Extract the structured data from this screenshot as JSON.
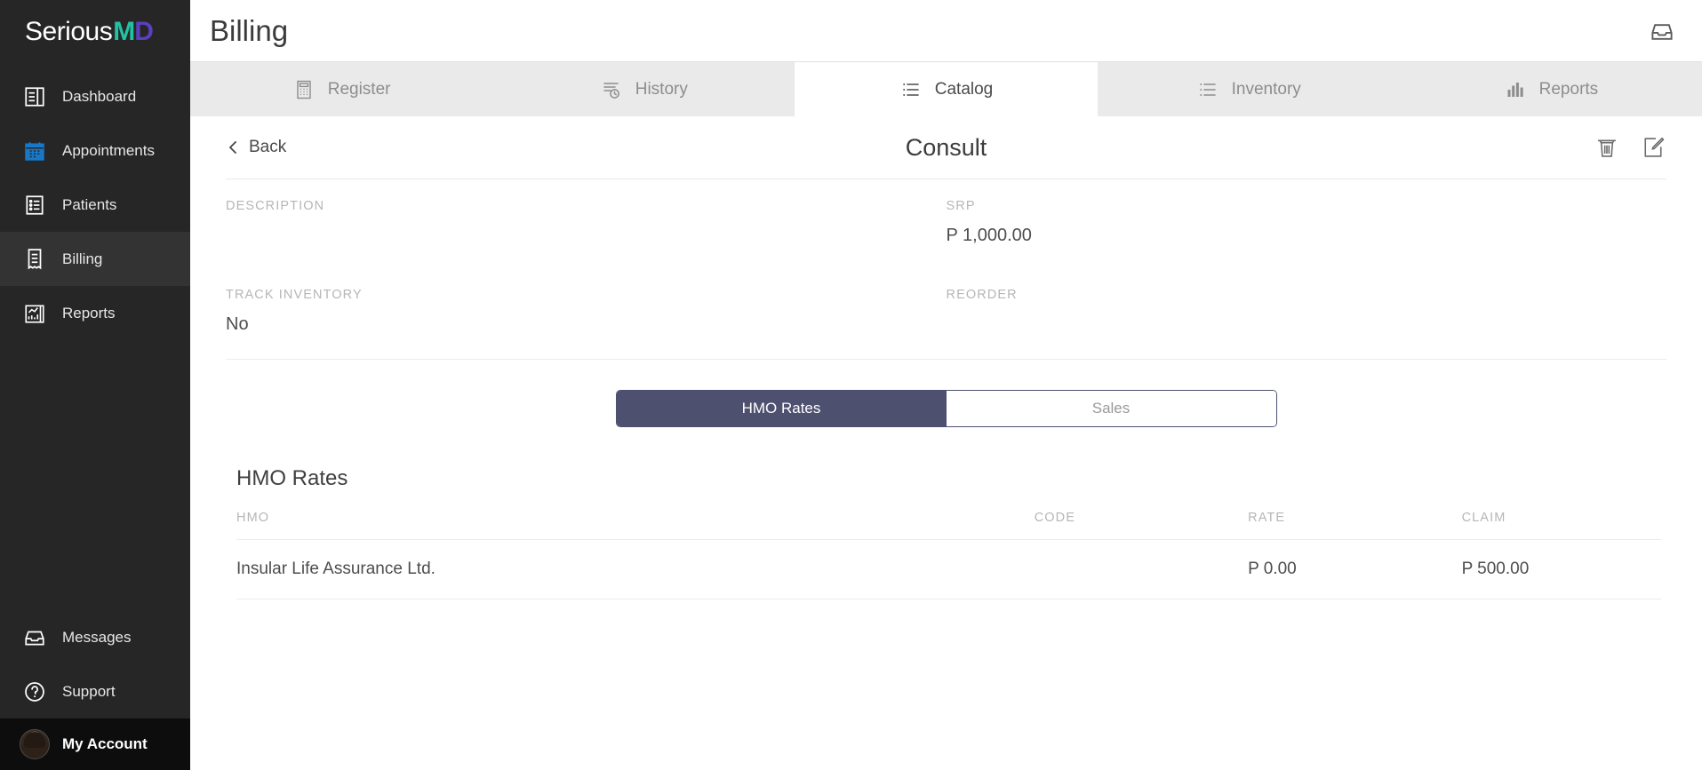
{
  "sidebar": {
    "logo": {
      "text_plain": "Serious",
      "text_m": "M",
      "text_d": "D"
    },
    "items": [
      {
        "label": "Dashboard",
        "icon": "dashboard-icon",
        "active": false
      },
      {
        "label": "Appointments",
        "icon": "calendar-icon",
        "active": false
      },
      {
        "label": "Patients",
        "icon": "patient-list-icon",
        "active": false
      },
      {
        "label": "Billing",
        "icon": "receipt-icon",
        "active": true
      },
      {
        "label": "Reports",
        "icon": "report-chart-icon",
        "active": false
      }
    ],
    "bottom_items": [
      {
        "label": "Messages",
        "icon": "inbox-icon"
      },
      {
        "label": "Support",
        "icon": "question-circle-icon"
      }
    ],
    "account": {
      "label": "My Account",
      "icon": "avatar"
    }
  },
  "header": {
    "title": "Billing",
    "inbox_icon": "inbox-icon"
  },
  "tabs": [
    {
      "label": "Register",
      "icon": "calculator-icon",
      "active": false
    },
    {
      "label": "History",
      "icon": "history-clock-icon",
      "active": false
    },
    {
      "label": "Catalog",
      "icon": "list-icon",
      "active": true
    },
    {
      "label": "Inventory",
      "icon": "list-icon",
      "active": false
    },
    {
      "label": "Reports",
      "icon": "bar-chart-icon",
      "active": false
    }
  ],
  "detail": {
    "back_label": "Back",
    "title": "Consult",
    "delete_icon": "trash-icon",
    "edit_icon": "edit-document-icon",
    "fields": [
      {
        "label": "DESCRIPTION",
        "value": ""
      },
      {
        "label": "SRP",
        "value": "P 1,000.00"
      },
      {
        "label": "TRACK INVENTORY",
        "value": "No"
      },
      {
        "label": "REORDER",
        "value": ""
      }
    ]
  },
  "segmented": {
    "options": [
      {
        "label": "HMO Rates",
        "active": true
      },
      {
        "label": "Sales",
        "active": false
      }
    ],
    "active_color": "#4e5070"
  },
  "table": {
    "title": "HMO Rates",
    "columns": [
      "HMO",
      "CODE",
      "RATE",
      "CLAIM"
    ],
    "rows": [
      {
        "hmo": "Insular Life Assurance Ltd.",
        "code": "",
        "rate": "P 0.00",
        "claim": "P 500.00"
      }
    ]
  }
}
